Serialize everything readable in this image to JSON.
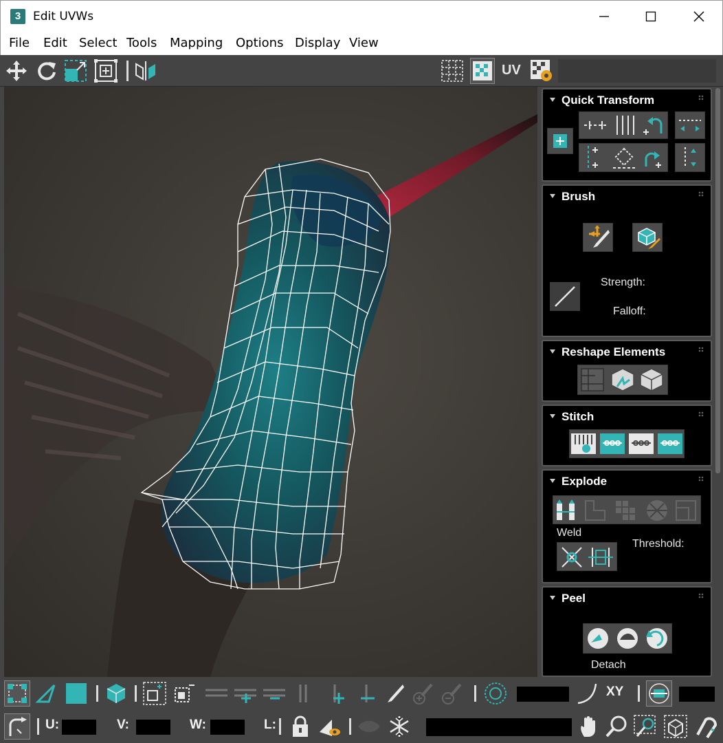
{
  "window": {
    "title": "Edit UVWs",
    "app_badge": "3"
  },
  "menu": [
    "File",
    "Edit",
    "Select",
    "Tools",
    "Mapping",
    "Options",
    "Display",
    "View"
  ],
  "toolbar": {
    "uv_label": "UV"
  },
  "rollouts": {
    "quick_transform": {
      "title": "Quick Transform"
    },
    "brush": {
      "title": "Brush",
      "strength_label": "Strength:",
      "falloff_label": "Falloff:"
    },
    "reshape": {
      "title": "Reshape Elements"
    },
    "stitch": {
      "title": "Stitch"
    },
    "explode": {
      "title": "Explode",
      "weld_label": "Weld",
      "threshold_label": "Threshold:"
    },
    "peel": {
      "title": "Peel",
      "detach_label": "Detach"
    }
  },
  "bottom": {
    "xy_label": "XY",
    "u_label": "U:",
    "v_label": "V:",
    "w_label": "W:",
    "l_label": "L:"
  },
  "colors": {
    "accent": "#33b5b5",
    "panel": "#444444",
    "rollout_bg": "#000000",
    "wire": "#ffffff",
    "beak": "#8a1d2e"
  }
}
